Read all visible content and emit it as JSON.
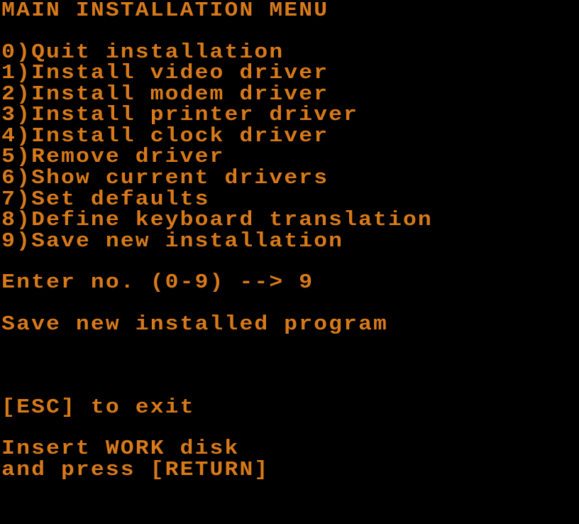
{
  "title": "MAIN INSTALLATION MENU",
  "menu": {
    "items": [
      {
        "num": "0",
        "label": "Quit installation"
      },
      {
        "num": "1",
        "label": "Install video driver"
      },
      {
        "num": "2",
        "label": "Install modem driver"
      },
      {
        "num": "3",
        "label": "Install printer driver"
      },
      {
        "num": "4",
        "label": "Install clock driver"
      },
      {
        "num": "5",
        "label": "Remove driver"
      },
      {
        "num": "6",
        "label": "Show current drivers"
      },
      {
        "num": "7",
        "label": "Set defaults"
      },
      {
        "num": "8",
        "label": "Define keyboard translation"
      },
      {
        "num": "9",
        "label": "Save new installation"
      }
    ]
  },
  "prompt": {
    "label": "Enter no. (0-9) --> ",
    "value": "9"
  },
  "status": "Save new installed program",
  "hint_exit": "[ESC] to exit",
  "instruction1": "Insert WORK disk",
  "instruction2": "and press [RETURN]"
}
